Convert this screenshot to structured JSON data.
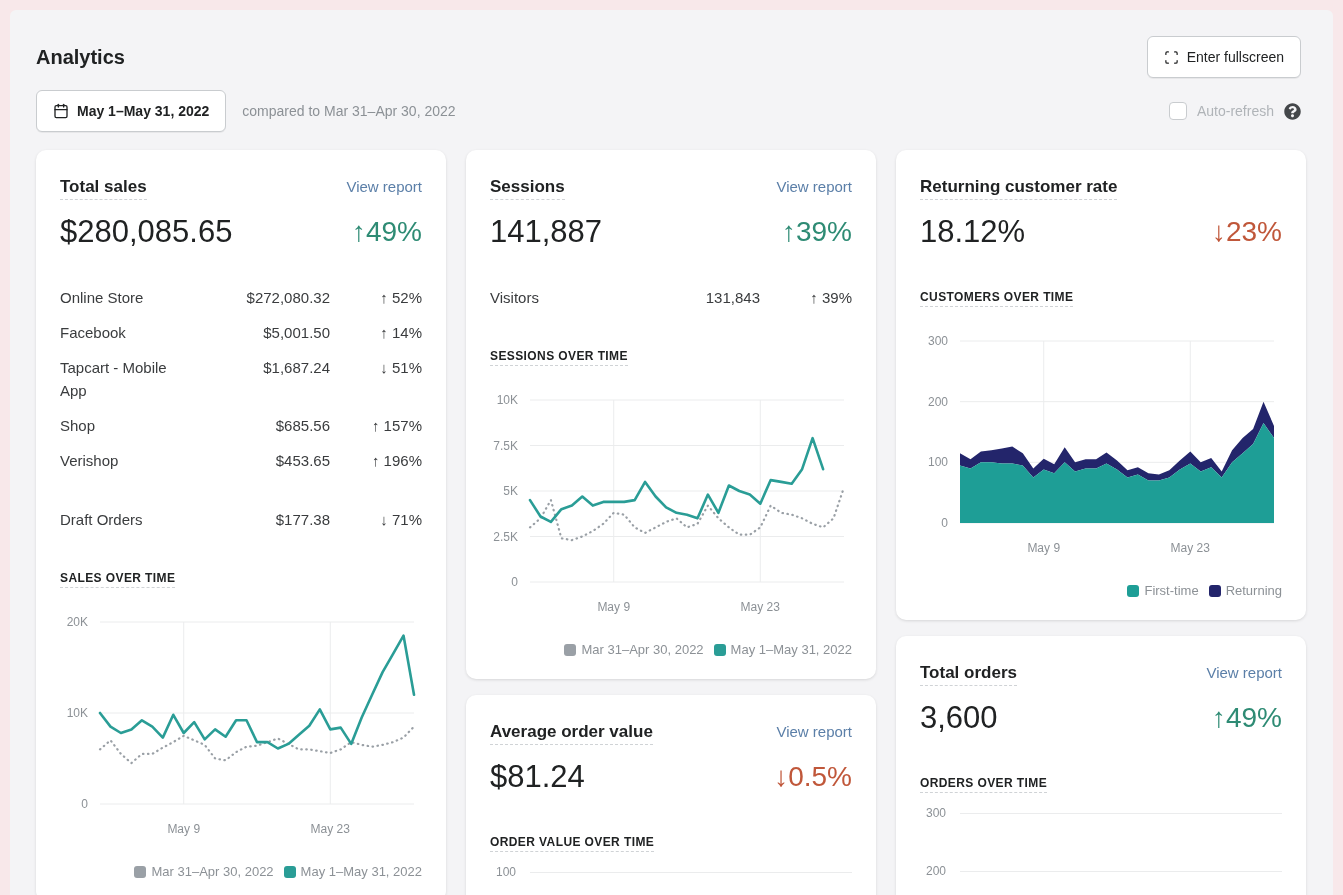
{
  "page": {
    "title": "Analytics",
    "fullscreen_button": "Enter fullscreen"
  },
  "toolbar": {
    "date_range": "May 1–May 31, 2022",
    "comparison": "compared to Mar 31–Apr 30, 2022",
    "auto_refresh": {
      "label": "Auto-refresh",
      "checked": false
    }
  },
  "columns": [
    {
      "cards": [
        {
          "title": "Total sales",
          "link": "View report",
          "value": "$280,085.65",
          "change": {
            "text": "↑49%",
            "color": "#2e8b74"
          },
          "breakdown_groups": [
            {
              "rows": [
                {
                  "label": "Online Store",
                  "value": "$272,080.32",
                  "change": "↑ 52%"
                },
                {
                  "label": "Facebook",
                  "value": "$5,001.50",
                  "change": "↑ 14%"
                },
                {
                  "label": "Tapcart - Mobile App",
                  "value": "$1,687.24",
                  "change": "↓ 51%"
                },
                {
                  "label": "Shop",
                  "value": "$685.56",
                  "change": "↑ 157%"
                },
                {
                  "label": "Verishop",
                  "value": "$453.65",
                  "change": "↑ 196%"
                }
              ]
            },
            {
              "rows": [
                {
                  "label": "Draft Orders",
                  "value": "$177.38",
                  "change": "↓ 71%"
                }
              ]
            }
          ],
          "section_label": "SALES OVER TIME",
          "chart_data": {
            "type": "line",
            "grid": true,
            "categories": [
              null,
              null,
              null,
              null,
              null,
              null,
              null,
              null,
              "May 9",
              null,
              null,
              null,
              null,
              null,
              null,
              null,
              null,
              null,
              null,
              null,
              null,
              null,
              "May 23",
              null,
              null,
              null,
              null,
              null,
              null,
              null,
              null
            ],
            "ylim": [
              0,
              20000
            ],
            "yticks": [
              {
                "value": 0,
                "label": "0"
              },
              {
                "value": 10000,
                "label": "10K"
              },
              {
                "value": 20000,
                "label": "20K"
              }
            ],
            "series": [
              {
                "name": "Mar 31–Apr 30, 2022",
                "color": "#9aa0a6",
                "line_style": "dotted",
                "values": [
                  6000,
                  7000,
                  5500,
                  4500,
                  5500,
                  5500,
                  6200,
                  6800,
                  7500,
                  7000,
                  6500,
                  5000,
                  4800,
                  5700,
                  6300,
                  6400,
                  6800,
                  7200,
                  6600,
                  6000,
                  6000,
                  5800,
                  5600,
                  6000,
                  6800,
                  6500,
                  6300,
                  6500,
                  6800,
                  7300,
                  8500
                ]
              },
              {
                "name": "May 1–May 31, 2022",
                "color": "#2a9d96",
                "line_style": "solid",
                "values": [
                  10000,
                  8500,
                  7800,
                  8200,
                  9200,
                  8500,
                  7300,
                  9800,
                  7800,
                  9000,
                  7100,
                  8200,
                  7400,
                  9200,
                  9200,
                  6800,
                  6800,
                  6100,
                  6600,
                  7600,
                  8600,
                  10400,
                  8200,
                  8400,
                  6600,
                  9500,
                  12000,
                  14500,
                  16500,
                  18500,
                  12000
                ]
              }
            ]
          }
        }
      ]
    },
    {
      "cards": [
        {
          "title": "Sessions",
          "link": "View report",
          "value": "141,887",
          "change": {
            "text": "↑39%",
            "color": "#2e8b74"
          },
          "breakdown_groups": [
            {
              "rows": [
                {
                  "label": "Visitors",
                  "value": "131,843",
                  "change": "↑ 39%"
                }
              ]
            }
          ],
          "section_label": "SESSIONS OVER TIME",
          "chart_data": {
            "type": "line",
            "grid": true,
            "categories": [
              null,
              null,
              null,
              null,
              null,
              null,
              null,
              null,
              "May 9",
              null,
              null,
              null,
              null,
              null,
              null,
              null,
              null,
              null,
              null,
              null,
              null,
              null,
              "May 23",
              null,
              null,
              null,
              null,
              null,
              null,
              null,
              null
            ],
            "ylim": [
              0,
              10000
            ],
            "yticks": [
              {
                "value": 0,
                "label": "0"
              },
              {
                "value": 2500,
                "label": "2.5K"
              },
              {
                "value": 5000,
                "label": "5K"
              },
              {
                "value": 7500,
                "label": "7.5K"
              },
              {
                "value": 10000,
                "label": "10K"
              }
            ],
            "series": [
              {
                "name": "Mar 31–Apr 30, 2022",
                "color": "#9aa0a6",
                "line_style": "dotted",
                "values": [
                  3000,
                  3500,
                  4500,
                  2400,
                  2300,
                  2500,
                  2800,
                  3200,
                  3800,
                  3700,
                  3000,
                  2700,
                  3000,
                  3300,
                  3500,
                  3000,
                  3200,
                  4200,
                  3500,
                  3000,
                  2600,
                  2600,
                  3000,
                  4200,
                  3800,
                  3700,
                  3500,
                  3200,
                  3000,
                  3500,
                  5200
                ]
              },
              {
                "name": "May 1–May 31, 2022",
                "color": "#2a9d96",
                "line_style": "solid",
                "values": [
                  4500,
                  3600,
                  3300,
                  4000,
                  4200,
                  4700,
                  4200,
                  4400,
                  4400,
                  4400,
                  4500,
                  5500,
                  4700,
                  4100,
                  3800,
                  3700,
                  3500,
                  4800,
                  3800,
                  5300,
                  5000,
                  4800,
                  4300,
                  5600,
                  5500,
                  5400,
                  6200,
                  7900,
                  6200,
                  null,
                  null
                ]
              }
            ]
          }
        },
        {
          "title": "Average order value",
          "link": "View report",
          "value": "$81.24",
          "change": {
            "text": "↓0.5%",
            "color": "#c0573a"
          },
          "section_label": "ORDER VALUE OVER TIME",
          "visible_ticks": [
            "100"
          ]
        }
      ]
    },
    {
      "cards": [
        {
          "title": "Returning customer rate",
          "value": "18.12%",
          "change": {
            "text": "↓23%",
            "color": "#c0573a"
          },
          "section_label": "CUSTOMERS OVER TIME",
          "chart_data": {
            "type": "area",
            "stacked": true,
            "grid": true,
            "categories": [
              null,
              null,
              null,
              null,
              null,
              null,
              null,
              null,
              "May 9",
              null,
              null,
              null,
              null,
              null,
              null,
              null,
              null,
              null,
              null,
              null,
              null,
              null,
              "May 23",
              null,
              null,
              null,
              null,
              null,
              null,
              null,
              null
            ],
            "ylim": [
              0,
              300
            ],
            "yticks": [
              {
                "value": 0,
                "label": "0"
              },
              {
                "value": 100,
                "label": "100"
              },
              {
                "value": 200,
                "label": "200"
              },
              {
                "value": 300,
                "label": "300"
              }
            ],
            "series": [
              {
                "name": "First-time",
                "color": "#1e9e96",
                "values": [
                  95,
                  90,
                  100,
                  100,
                  98,
                  98,
                  95,
                  75,
                  88,
                  82,
                  100,
                  85,
                  90,
                  90,
                  98,
                  88,
                  75,
                  80,
                  70,
                  70,
                  75,
                  88,
                  98,
                  85,
                  92,
                  75,
                  100,
                  115,
                  130,
                  165,
                  140
                ]
              },
              {
                "name": "Returning",
                "color": "#23256b",
                "values": [
                  20,
                  15,
                  18,
                  20,
                  25,
                  28,
                  20,
                  15,
                  18,
                  15,
                  25,
                  15,
                  15,
                  15,
                  18,
                  15,
                  12,
                  12,
                  12,
                  10,
                  12,
                  15,
                  20,
                  15,
                  15,
                  10,
                  20,
                  25,
                  25,
                  35,
                  20
                ]
              }
            ]
          }
        },
        {
          "title": "Total orders",
          "link": "View report",
          "value": "3,600",
          "change": {
            "text": "↑49%",
            "color": "#2e8b74"
          },
          "section_label": "ORDERS OVER TIME",
          "visible_ticks": [
            "300",
            "200"
          ]
        }
      ]
    }
  ]
}
